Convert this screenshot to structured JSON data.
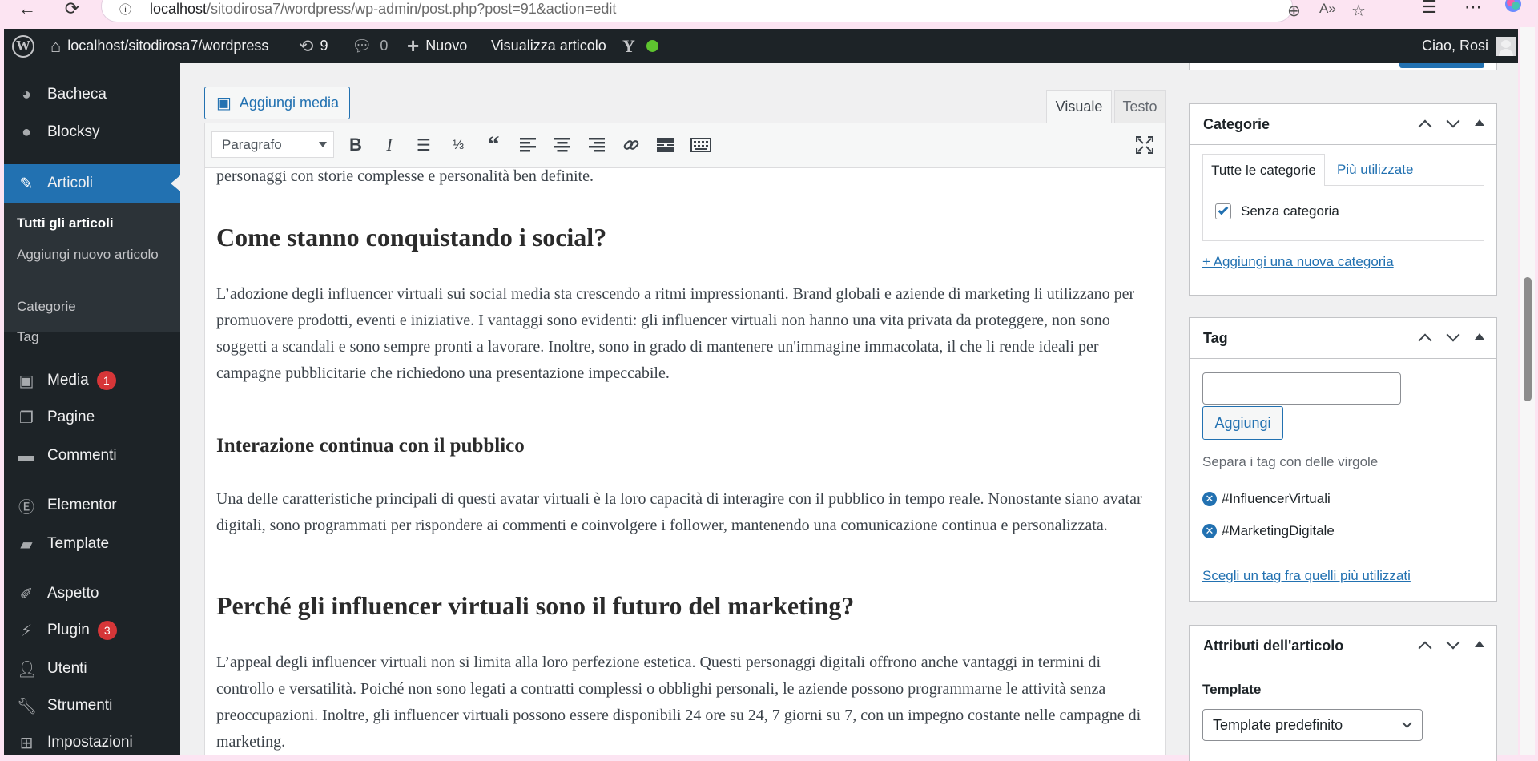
{
  "browser": {
    "url_host": "localhost",
    "url_path": "/sitodirosa7/wordpress/wp-admin/post.php?post=91&action=edit"
  },
  "adminbar": {
    "site": "localhost/sitodirosa7/wordpress",
    "updates_count": "9",
    "comments_count": "0",
    "new_label": "Nuovo",
    "view_label": "Visualizza articolo",
    "greeting": "Ciao, Rosi"
  },
  "sidebar": {
    "items": [
      {
        "label": "Bacheca",
        "icon": "dashboard-icon"
      },
      {
        "label": "Blocksy",
        "icon": "blocksy-icon"
      },
      {
        "label": "Articoli",
        "icon": "pin-icon"
      },
      {
        "label": "Media",
        "icon": "media-icon",
        "badge": "1"
      },
      {
        "label": "Pagine",
        "icon": "pages-icon"
      },
      {
        "label": "Commenti",
        "icon": "comments-icon"
      },
      {
        "label": "Elementor",
        "icon": "elementor-icon"
      },
      {
        "label": "Template",
        "icon": "folder-icon"
      },
      {
        "label": "Aspetto",
        "icon": "brush-icon"
      },
      {
        "label": "Plugin",
        "icon": "plugin-icon",
        "badge": "3"
      },
      {
        "label": "Utenti",
        "icon": "user-icon"
      },
      {
        "label": "Strumenti",
        "icon": "wrench-icon"
      },
      {
        "label": "Impostazioni",
        "icon": "settings-icon"
      }
    ],
    "submenu": [
      "Tutti gli articoli",
      "Aggiungi nuovo articolo",
      "Categorie",
      "Tag"
    ]
  },
  "editor": {
    "add_media": "Aggiungi media",
    "tab_visual": "Visuale",
    "tab_text": "Testo",
    "format": "Paragrafo",
    "content": {
      "p0": "personaggi con storie complesse e personalità ben definite.",
      "h2a": "Come stanno conquistando i social?",
      "p1": "L’adozione degli influencer virtuali sui social media sta crescendo a ritmi impressionanti. Brand globali e aziende di marketing li utilizzano per promuovere prodotti, eventi e iniziative. I vantaggi sono evidenti: gli influencer virtuali non hanno una vita privata da proteggere, non sono soggetti a scandali e sono sempre pronti a lavorare. Inoltre, sono in grado di mantenere un'immagine immacolata, il che li rende ideali per campagne pubblicitarie che richiedono una presentazione impeccabile.",
      "h3a": "Interazione continua con il pubblico",
      "p2": "Una delle caratteristiche principali di questi avatar virtuali è la loro capacità di interagire con il pubblico in tempo reale. Nonostante siano avatar digitali, sono programmati per rispondere ai commenti e coinvolgere i follower, mantenendo una comunicazione continua e personalizzata.",
      "h2b": "Perché gli influencer virtuali sono il futuro del marketing?",
      "p3": "L’appeal degli influencer virtuali non si limita alla loro perfezione estetica. Questi personaggi digitali offrono anche vantaggi in termini di controllo e versatilità. Poiché non sono legati a contratti complessi o obblighi personali, le aziende possono programmarne le attività senza preoccupazioni. Inoltre, gli influencer virtuali possono essere disponibili 24 ore su 24, 7 giorni su 7, con un impegno costante nelle campagne di marketing."
    }
  },
  "categories": {
    "title": "Categorie",
    "tab_all": "Tutte le categorie",
    "tab_popular": "Più utilizzate",
    "items": [
      {
        "label": "Senza categoria",
        "checked": true
      }
    ],
    "add_link": "+ Aggiungi una nuova categoria"
  },
  "tags": {
    "title": "Tag",
    "input_value": "",
    "add_button": "Aggiungi",
    "hint": "Separa i tag con delle virgole",
    "items": [
      "#InfluencerVirtuali",
      "#MarketingDigitale"
    ],
    "choose_link": "Scegli un tag fra quelli più utilizzati"
  },
  "attributes": {
    "title": "Attributi dell'articolo",
    "template_label": "Template",
    "template_value": "Template predefinito"
  },
  "colors": {
    "accent": "#2271b1",
    "adminbar": "#1d2327",
    "badge": "#d63638",
    "status_dot": "#5ec42f"
  }
}
